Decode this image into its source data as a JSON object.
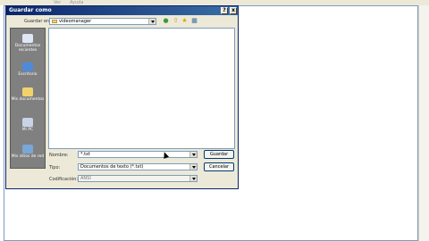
{
  "notepad": {
    "menu": [
      "Ver",
      "Ayuda"
    ]
  },
  "dialog": {
    "title": "Guardar como",
    "close_glyph": "x",
    "help_glyph": "?",
    "save_in_label": "Guardar en:",
    "save_in_value": "videomanager",
    "places": [
      {
        "label": "Documentos recientes",
        "icon": "recent-documents-icon"
      },
      {
        "label": "Escritorio",
        "icon": "desktop-icon"
      },
      {
        "label": "Mis documentos",
        "icon": "my-documents-icon"
      },
      {
        "label": "Mi PC",
        "icon": "my-computer-icon"
      },
      {
        "label": "Mis sitios de red",
        "icon": "network-places-icon"
      }
    ],
    "filename_label": "Nombre:",
    "filename_value": "*.txt",
    "type_label": "Tipo:",
    "type_value": "Documentos de texto (*.txt)",
    "encoding_label": "Codificación:",
    "encoding_value": "ANSI",
    "save_button": "Guardar",
    "cancel_button": "Cancelar"
  },
  "colors": {
    "titlebar": "#0a246a",
    "dialog_bg": "#ece9d8",
    "places_bg": "#808080"
  }
}
